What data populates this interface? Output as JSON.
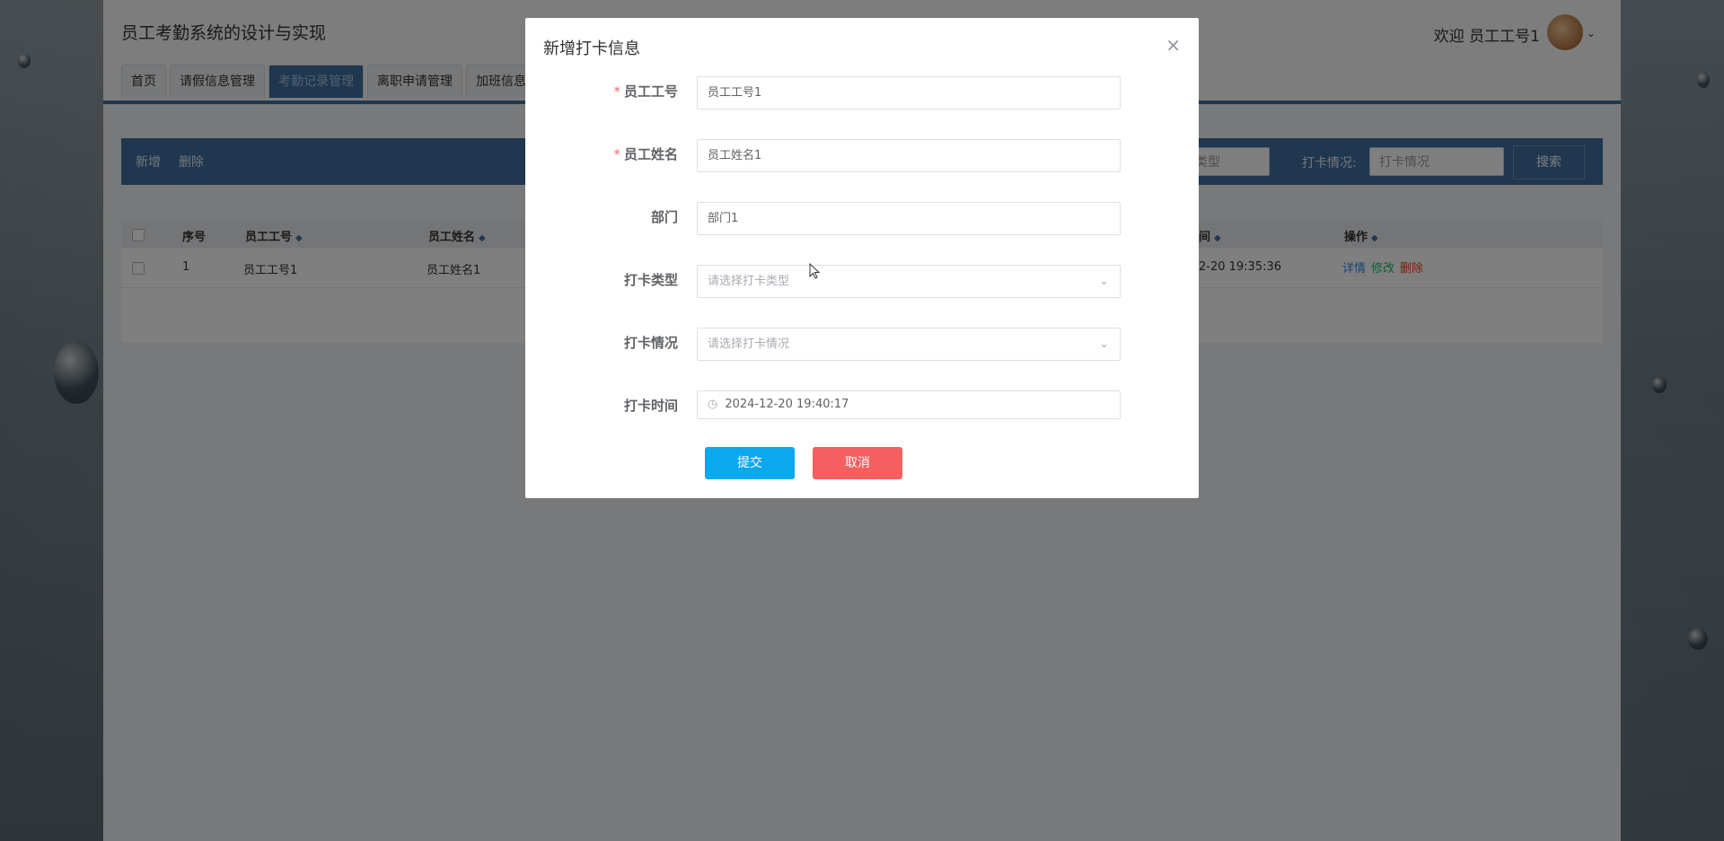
{
  "app": {
    "title": "员工考勤系统的设计与实现",
    "welcome": "欢迎 员工工号1"
  },
  "nav": {
    "items": [
      {
        "label": "首页"
      },
      {
        "label": "请假信息管理"
      },
      {
        "label": "考勤记录管理"
      },
      {
        "label": "离职申请管理"
      },
      {
        "label": "加班信息管理"
      }
    ]
  },
  "toolbar": {
    "add_label": "新增",
    "delete_label": "删除",
    "type_select_value": "类型",
    "status_label": "打卡情况:",
    "status_select_placeholder": "打卡情况",
    "search_label": "搜索"
  },
  "table": {
    "headers": {
      "index": "序号",
      "emp_no": "员工工号",
      "emp_name": "员工姓名",
      "time": "间",
      "ops": "操作"
    },
    "rows": [
      {
        "index": "1",
        "emp_no": "员工工号1",
        "emp_name": "员工姓名1",
        "time": "2-20 19:35:36"
      }
    ],
    "ops": {
      "detail": "详情",
      "edit": "修改",
      "delete": "删除"
    }
  },
  "dialog": {
    "title": "新增打卡信息",
    "close": "×",
    "fields": {
      "emp_no_label": "员工工号",
      "emp_no_value": "员工工号1",
      "emp_name_label": "员工姓名",
      "emp_name_value": "员工姓名1",
      "dept_label": "部门",
      "dept_value": "部门1",
      "type_label": "打卡类型",
      "type_placeholder": "请选择打卡类型",
      "status_label": "打卡情况",
      "status_placeholder": "请选择打卡情况",
      "time_label": "打卡时间",
      "time_value": "2024-12-20 19:40:17"
    },
    "submit_label": "提交",
    "cancel_label": "取消"
  }
}
